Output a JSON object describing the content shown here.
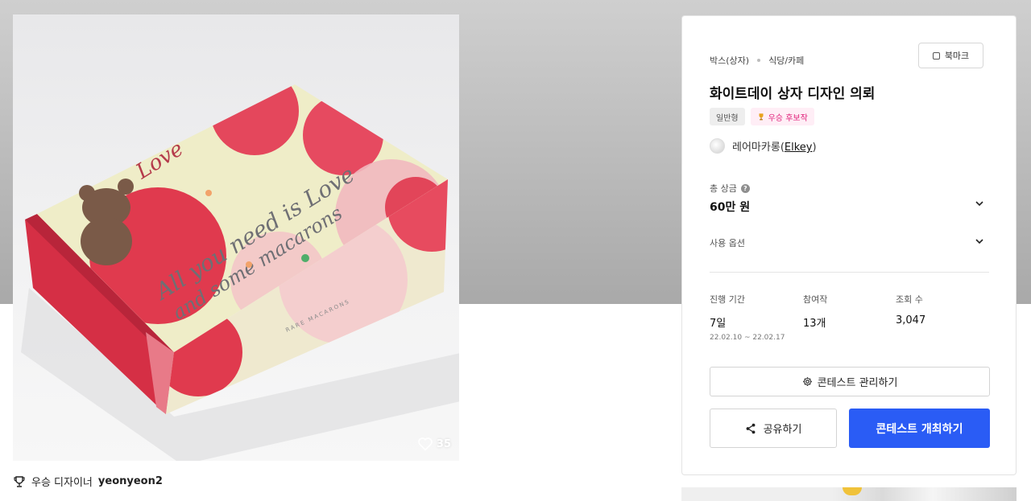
{
  "image": {
    "box_text_line1": "All you need is Love",
    "box_text_line2": "and some macarons",
    "box_script": "Love",
    "box_brand": "RARE MACARONS",
    "like_count": "35"
  },
  "winner": {
    "label": "우승 디자이너",
    "name": "yeonyeon2"
  },
  "panel": {
    "bookmark_label": "북마크",
    "breadcrumbs": [
      "박스(상자)",
      "식당/카페"
    ],
    "title": "화이트데이 상자 디자인 의뢰",
    "tags": {
      "general": "일반형",
      "award": "우승 후보작"
    },
    "host": {
      "name": "레어마카롱",
      "handle": "Elkey"
    },
    "prize": {
      "label": "총 상금",
      "help": "?",
      "value": "60만 원"
    },
    "usage": {
      "label": "사용 옵션"
    },
    "stats": {
      "period_label": "진행 기간",
      "period_value": "7일",
      "period_range": "22.02.10 ~ 22.02.17",
      "entries_label": "참여작",
      "entries_value": "13개",
      "views_label": "조회 수",
      "views_value": "3,047"
    },
    "manage_label": "콘테스트 관리하기",
    "share_label": "공유하기",
    "host_contest_label": "콘테스트 개최하기"
  },
  "colors": {
    "primary": "#2a5cf5",
    "award_pink": "#e0207a",
    "box_red": "#e03a4e",
    "box_cream": "#efedc8"
  }
}
